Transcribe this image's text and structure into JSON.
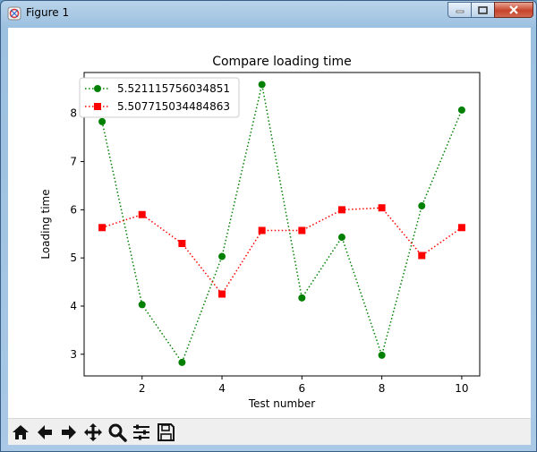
{
  "window": {
    "title": "Figure 1"
  },
  "toolbar": {
    "buttons": [
      {
        "name": "home-icon"
      },
      {
        "name": "back-arrow-icon"
      },
      {
        "name": "forward-arrow-icon"
      },
      {
        "name": "pan-icon"
      },
      {
        "name": "zoom-icon"
      },
      {
        "name": "configure-subplots-icon"
      },
      {
        "name": "save-icon"
      }
    ]
  },
  "chart_data": {
    "type": "line",
    "title": "Compare loading time",
    "xlabel": "Test number",
    "ylabel": "Loading time",
    "x": [
      1,
      2,
      3,
      4,
      5,
      6,
      7,
      8,
      9,
      10
    ],
    "xlim": [
      0.55,
      10.45
    ],
    "ylim": [
      2.55,
      8.85
    ],
    "xticks": [
      2,
      4,
      6,
      8,
      10
    ],
    "yticks": [
      3,
      4,
      5,
      6,
      7,
      8
    ],
    "grid": false,
    "legend_position": "top-left",
    "series": [
      {
        "name": "5.521115756034851",
        "color": "#008000",
        "marker": "circle",
        "linestyle": "dotted",
        "values": [
          7.83,
          4.03,
          2.83,
          5.03,
          8.6,
          4.17,
          5.43,
          2.98,
          6.08,
          8.07
        ]
      },
      {
        "name": "5.507715034484863",
        "color": "#ff0000",
        "marker": "square",
        "linestyle": "dotted",
        "values": [
          5.63,
          5.9,
          5.3,
          4.25,
          5.57,
          5.57,
          6.0,
          6.04,
          5.05,
          5.63
        ]
      }
    ]
  }
}
